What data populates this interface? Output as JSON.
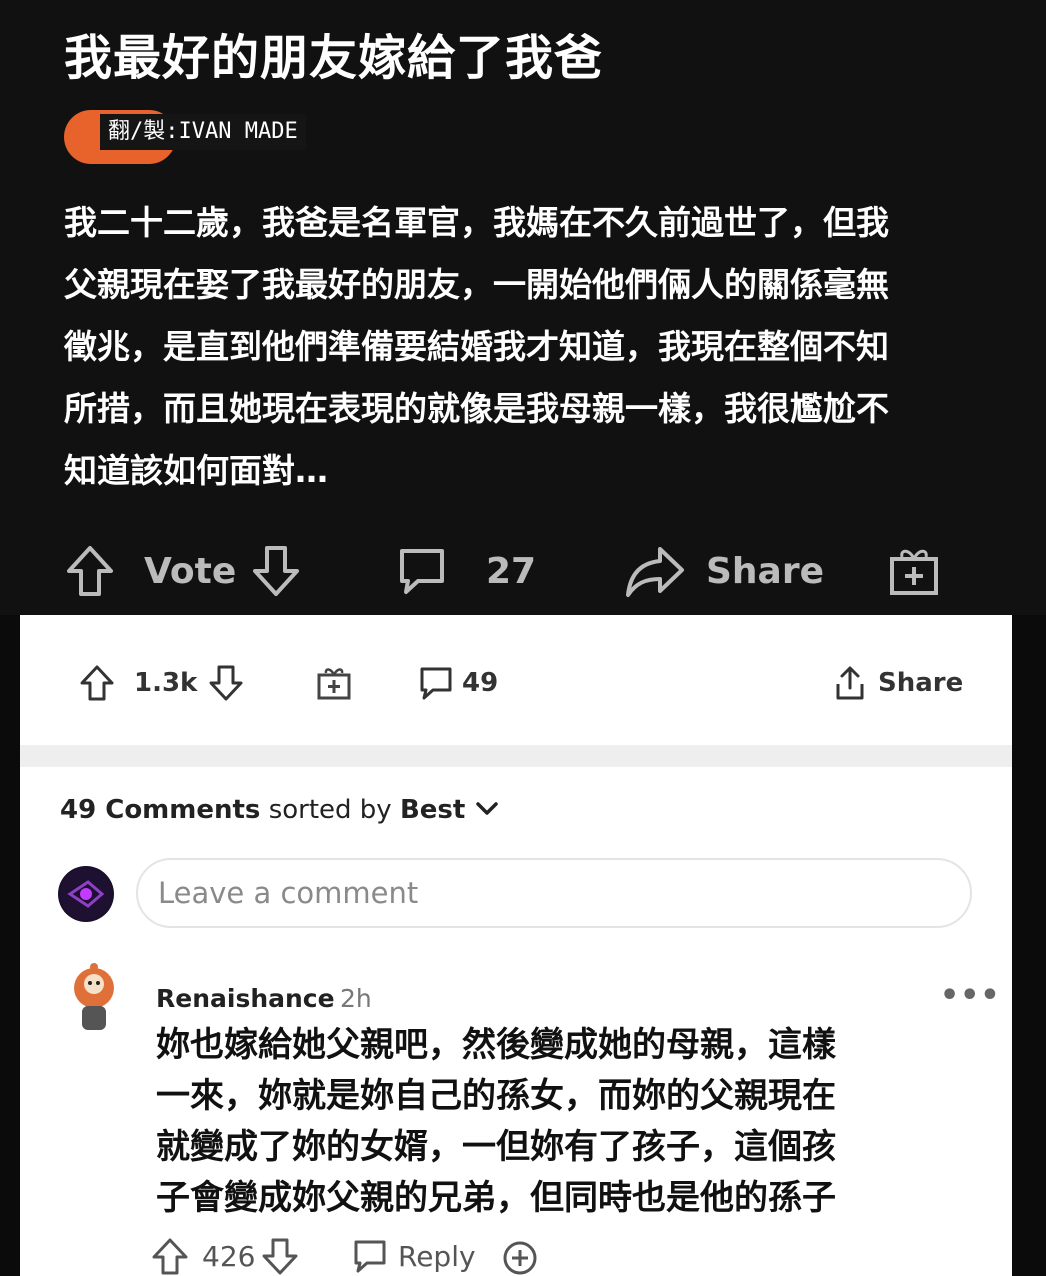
{
  "post": {
    "title": "我最好的朋友嫁給了我爸",
    "credit": "翻/製:IVAN MADE",
    "body_lines": [
      "我二十二歲，我爸是名軍官，我媽在不久前過世了，但我",
      "父親現在娶了我最好的朋友，一開始他們倆人的關係毫無",
      "徵兆，是直到他們準備要結婚我才知道，我現在整個不知",
      "所措，而且她現在表現的就像是我母親一樣，我很尷尬不",
      "知道該如何面對…"
    ],
    "vote_label": "Vote",
    "comments_count": "27",
    "share_label": "Share"
  },
  "bar": {
    "votes": "1.3k",
    "comments": "49",
    "share_label": "Share"
  },
  "comments_section": {
    "count_text": "49 Comments",
    "sorted_by": "sorted by",
    "sort_value": "Best",
    "placeholder": "Leave a comment"
  },
  "comment": {
    "username": "Renaishance",
    "time": "2h",
    "lines": [
      "妳也嫁給她父親吧，然後變成她的母親，這樣",
      "一來，妳就是妳自己的孫女，而妳的父親現在",
      "就變成了妳的女婿，一但妳有了孩子，這個孩",
      "子會變成妳父親的兄弟，但同時也是他的孫子"
    ],
    "votes": "426",
    "reply_label": "Reply"
  },
  "colors": {
    "accent": "#e8622c",
    "dark_bg": "#111111",
    "white_bg": "#ffffff"
  }
}
